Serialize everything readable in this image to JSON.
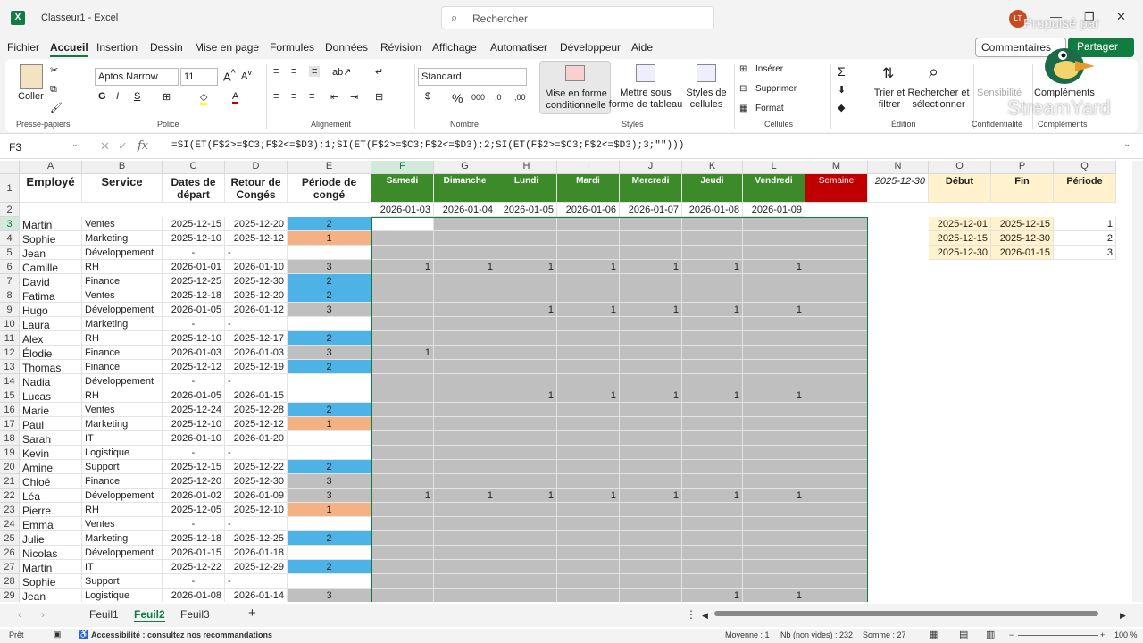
{
  "app": {
    "title": "Classeur1 - Excel",
    "logo": "X",
    "search_placeholder": "Rechercher",
    "avatar": "LT",
    "overlay1": "Propulsé par",
    "overlay2": "StreamYard"
  },
  "menu": [
    "Fichier",
    "Accueil",
    "Insertion",
    "Dessin",
    "Mise en page",
    "Formules",
    "Données",
    "Révision",
    "Affichage",
    "Automatiser",
    "Développeur",
    "Aide"
  ],
  "menu_active": "Accueil",
  "buttons": {
    "comment": "Commentaires",
    "share": "Partager"
  },
  "ribbon": {
    "paste": "Coller",
    "clipboard": "Presse-papiers",
    "font_name": "Aptos Narrow",
    "font_size": "11",
    "font_group": "Police",
    "align_group": "Alignement",
    "number_format": "Standard",
    "number_group": "Nombre",
    "cond_format": "Mise en forme conditionnelle",
    "table_format": "Mettre sous forme de tableau",
    "cell_styles": "Styles de cellules",
    "styles_group": "Styles",
    "insert": "Insérer",
    "delete": "Supprimer",
    "format": "Format",
    "cells_group": "Cellules",
    "sort": "Trier et filtrer",
    "find": "Rechercher et sélectionner",
    "edit_group": "Édition",
    "sensitivity": "Sensibilité",
    "privacy_group": "Confidentialité",
    "addins": "Compléments",
    "addins_group": "Compléments"
  },
  "formula_bar": {
    "cell": "F3",
    "formula": "=SI(ET(F$2>=$C3;F$2<=$D3);1;SI(ET(F$2>=$C3;F$2<=$D3);2;SI(ET(F$2>=$C3;F$2<=$D3);3;\"\")))"
  },
  "columns": [
    "A",
    "B",
    "C",
    "D",
    "E",
    "F",
    "G",
    "H",
    "I",
    "J",
    "K",
    "L",
    "M",
    "N",
    "O",
    "P",
    "Q"
  ],
  "header_row": {
    "A": "Employé",
    "B": "Service",
    "C": "Dates de départ",
    "D": "Retour de Congés",
    "E": "Période de congé",
    "F": "Samedi",
    "G": "Dimanche",
    "H": "Lundi",
    "I": "Mardi",
    "J": "Mercredi",
    "K": "Jeudi",
    "L": "Vendredi",
    "M": "Semaine",
    "N": "2025-12-30",
    "O": "Début",
    "P": "Fin",
    "Q": "Période"
  },
  "dates_row": [
    "2026-01-03",
    "2026-01-04",
    "2026-01-05",
    "2026-01-06",
    "2026-01-07",
    "2026-01-08",
    "2026-01-09"
  ],
  "periods": [
    [
      "2025-12-01",
      "2025-12-15",
      "1"
    ],
    [
      "2025-12-15",
      "2025-12-30",
      "2"
    ],
    [
      "2025-12-30",
      "2026-01-15",
      "3"
    ]
  ],
  "rows": [
    [
      "3",
      "Martin",
      "Ventes",
      "2025-12-15",
      "2025-12-20",
      "2",
      ""
    ],
    [
      "4",
      "Sophie",
      "Marketing",
      "2025-12-10",
      "2025-12-12",
      "1",
      ""
    ],
    [
      "5",
      "Jean",
      "Développement",
      "-",
      "-",
      "",
      ""
    ],
    [
      "6",
      "Camille",
      "RH",
      "2026-01-01",
      "2026-01-10",
      "3",
      "1111111"
    ],
    [
      "7",
      "David",
      "Finance",
      "2025-12-25",
      "2025-12-30",
      "2",
      ""
    ],
    [
      "8",
      "Fatima",
      "Ventes",
      "2025-12-18",
      "2025-12-20",
      "2",
      ""
    ],
    [
      "9",
      "Hugo",
      "Développement",
      "2026-01-05",
      "2026-01-12",
      "3",
      "0011111"
    ],
    [
      "10",
      "Laura",
      "Marketing",
      "-",
      "-",
      "",
      ""
    ],
    [
      "11",
      "Alex",
      "RH",
      "2025-12-10",
      "2025-12-17",
      "2",
      ""
    ],
    [
      "12",
      "Élodie",
      "Finance",
      "2026-01-03",
      "2026-01-03",
      "3",
      "1000000"
    ],
    [
      "13",
      "Thomas",
      "Finance",
      "2025-12-12",
      "2025-12-19",
      "2",
      ""
    ],
    [
      "14",
      "Nadia",
      "Développement",
      "-",
      "-",
      "",
      ""
    ],
    [
      "15",
      "Lucas",
      "RH",
      "2026-01-05",
      "2026-01-15",
      "",
      ""
    ],
    [
      "16",
      "Marie",
      "Ventes",
      "2025-12-24",
      "2025-12-28",
      "2",
      ""
    ],
    [
      "17",
      "Paul",
      "Marketing",
      "2025-12-10",
      "2025-12-12",
      "1",
      ""
    ],
    [
      "18",
      "Sarah",
      "IT",
      "2026-01-10",
      "2026-01-20",
      "",
      ""
    ],
    [
      "19",
      "Kevin",
      "Logistique",
      "-",
      "-",
      "",
      ""
    ],
    [
      "20",
      "Amine",
      "Support",
      "2025-12-15",
      "2025-12-22",
      "2",
      ""
    ],
    [
      "21",
      "Chloé",
      "Finance",
      "2025-12-20",
      "2025-12-30",
      "3",
      ""
    ],
    [
      "22",
      "Léa",
      "Développement",
      "2026-01-02",
      "2026-01-09",
      "3",
      "1111111"
    ],
    [
      "23",
      "Pierre",
      "RH",
      "2025-12-05",
      "2025-12-10",
      "1",
      ""
    ],
    [
      "24",
      "Emma",
      "Ventes",
      "-",
      "-",
      "",
      ""
    ],
    [
      "25",
      "Julie",
      "Marketing",
      "2025-12-18",
      "2025-12-25",
      "2",
      ""
    ],
    [
      "26",
      "Nicolas",
      "Développement",
      "2026-01-15",
      "2026-01-18",
      "",
      ""
    ],
    [
      "27",
      "Martin",
      "IT",
      "2025-12-22",
      "2025-12-29",
      "2",
      ""
    ],
    [
      "28",
      "Sophie",
      "Support",
      "-",
      "-",
      "",
      ""
    ],
    [
      "29",
      "Jean",
      "Logistique",
      "2026-01-08",
      "2026-01-14",
      "3",
      "0000011"
    ]
  ],
  "row15_ones": "0011111",
  "sheets": [
    "Feuil1",
    "Feuil2",
    "Feuil3"
  ],
  "active_sheet": "Feuil2",
  "status": {
    "ready": "Prêt",
    "access": "Accessibilité : consultez nos recommandations",
    "avg": "Moyenne : 1",
    "count": "Nb (non vides) : 232",
    "sum": "Somme : 27",
    "zoom": "100 %"
  },
  "colors": {
    "green": "#107c41",
    "blue": "#4db3e6",
    "salmon": "#f4b184",
    "gray": "#bfbfbf",
    "darkgreen": "#3d8a2a",
    "red": "#c00000",
    "yellow": "#fff2cc"
  }
}
